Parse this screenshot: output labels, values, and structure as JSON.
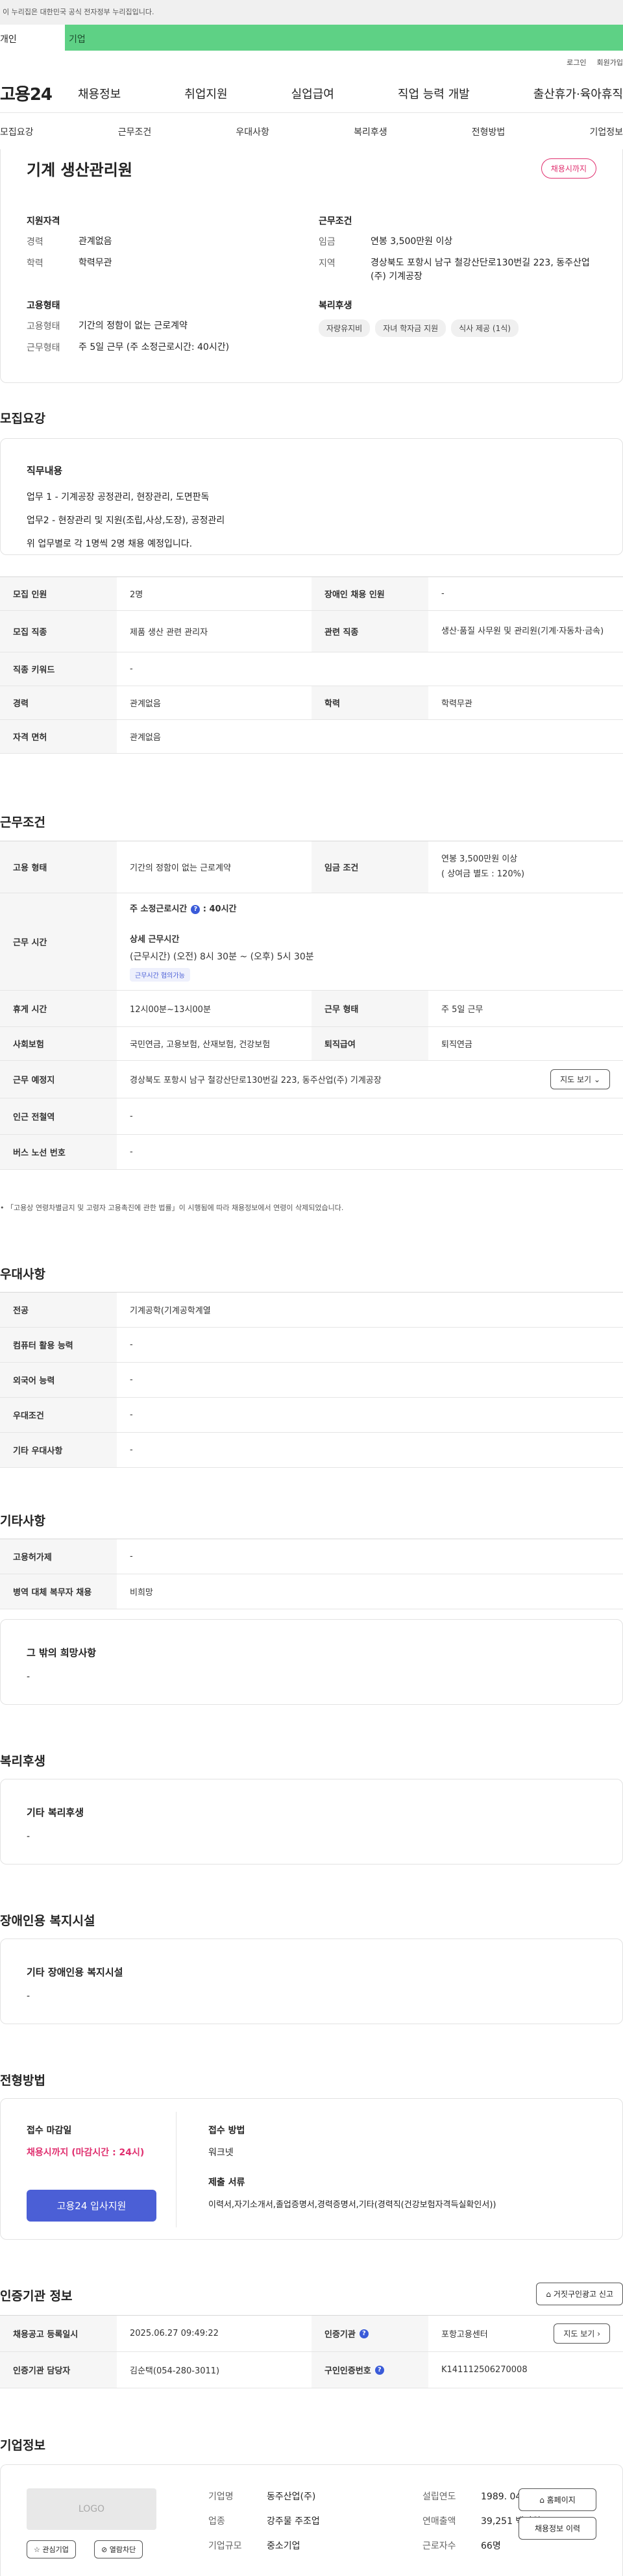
{
  "topbar": {
    "notice": "이 누리집은 대한민국 공식 전자정부 누리집입니다."
  },
  "tabs": {
    "personal": "개인",
    "company": "기업"
  },
  "util": {
    "login": "로그인",
    "join": "회원가입"
  },
  "gnb": {
    "logo": "고용24",
    "items": [
      "채용정보",
      "취업지원",
      "실업급여",
      "직업 능력 개발",
      "출산휴가·육아휴직"
    ]
  },
  "subnav": [
    "모집요강",
    "근무조건",
    "우대사항",
    "복리후생",
    "전형방법",
    "기업정보"
  ],
  "hero": {
    "title": "기계 생산관리원",
    "badge": "채용시까지",
    "qual_title": "지원자격",
    "qual": [
      {
        "k": "경력",
        "v": "관계없음"
      },
      {
        "k": "학력",
        "v": "학력무관"
      }
    ],
    "cond_title": "근무조건",
    "cond": [
      {
        "k": "임금",
        "v": "연봉 3,500만원 이상"
      },
      {
        "k": "지역",
        "v": "경상북도 포항시 남구 철강산단로130번길 223, 동주산업(주) 기계공장"
      }
    ],
    "emp_title": "고용형태",
    "emp": [
      {
        "k": "고용형태",
        "v": "기간의 정함이 없는 근로계약"
      },
      {
        "k": "근무형태",
        "v": "주 5일 근무 (주 소정근로시간: 40시간)"
      }
    ],
    "welfare_title": "복리후생",
    "welfare": [
      "자량유지비",
      "자녀 학자금 지원",
      "식사 제공 (1식)"
    ]
  },
  "recruit": {
    "title": "모집요강",
    "duty_title": "직무내용",
    "duties": [
      "업무 1 - 기계공장 공정관리, 현장관리, 도면판독",
      "업무2 - 현장관리 및 지원(조립,사상,도장), 공정관리",
      "위 업무별로 각 1명씩 2명 채용 예정입니다."
    ],
    "r1": {
      "k1": "모집 인원",
      "v1": "2명",
      "k2": "장애인 채용 인원",
      "v2": "-"
    },
    "r2": {
      "k1": "모집 직종",
      "v1": "제품 생산 관련 관리자",
      "k2": "관련 직종",
      "v2": "생산·품질 사무원 및 관리원(기계·자동차·금속)"
    },
    "r3": {
      "k": "직종 키워드",
      "v": "-"
    },
    "r4": {
      "k1": "경력",
      "v1": "관계없음",
      "k2": "학력",
      "v2": "학력무관"
    },
    "r5": {
      "k": "자격 면허",
      "v": "관계없음"
    }
  },
  "work": {
    "title": "근무조건",
    "r1": {
      "k1": "고용 형태",
      "v1": "기간의 정함이 없는 근로계약",
      "k2": "임금 조건",
      "v2a": "연봉 3,500만원 이상",
      "v2b": "( 상여금 별도 : 120%)"
    },
    "r2": {
      "k": "근무 시간",
      "std": "주 소정근로시간",
      "std_val": ": 40시간",
      "detail_title": "상세 근무시간",
      "detail": "(근무시간) (오전) 8시 30분 ~ (오후) 5시 30분",
      "chip": "근무시간 협의가능"
    },
    "r3": {
      "k1": "휴게 시간",
      "v1": "12시00분~13시00분",
      "k2": "근무 형태",
      "v2": "주 5일 근무"
    },
    "r4": {
      "k1": "사회보험",
      "v1": "국민연금, 고용보험, 산재보험, 건강보험",
      "k2": "퇴직급여",
      "v2": "퇴직연금"
    },
    "r5": {
      "k": "근무 예정지",
      "v": "경상북도 포항시 남구 철강산단로130번길 223, 동주산업(주) 기계공장",
      "btn": "지도 보기"
    },
    "r6": {
      "k": "인근 전철역",
      "v": "-"
    },
    "r7": {
      "k": "버스 노선 번호",
      "v": "-"
    },
    "note": "「고용상 연령차별금지 및 고령자 고용촉진에 관한 법률」이 시행됨에 따라 채용정보에서 연령이 삭제되었습니다."
  },
  "pref": {
    "title": "우대사항",
    "rows": [
      {
        "k": "전공",
        "v": "기계공학(기계공학계열"
      },
      {
        "k": "컴퓨터 활용 능력",
        "v": "-"
      },
      {
        "k": "외국어 능력",
        "v": "-"
      },
      {
        "k": "우대조건",
        "v": "-"
      },
      {
        "k": "기타 우대사항",
        "v": "-"
      }
    ]
  },
  "etc": {
    "title": "기타사항",
    "rows": [
      {
        "k": "고용허가제",
        "v": "-"
      },
      {
        "k": "병역 대체 복무자 채용",
        "v": "비희망"
      }
    ],
    "box_title": "그 밖의 희망사항",
    "box_value": "-"
  },
  "welfare": {
    "title": "복리후생",
    "box_title": "기타 복리후생",
    "box_value": "-"
  },
  "disabled": {
    "title": "장애인용 복지시설",
    "box_title": "기타 장애인용 복지시설",
    "box_value": "-"
  },
  "process": {
    "title": "전형방법",
    "deadline_title": "접수 마감일",
    "deadline": "채용시까지 (마감시간 : 24시)",
    "apply": "고용24 입사지원",
    "method_title": "접수 방법",
    "method": "워크넷",
    "docs_title": "제출 서류",
    "docs": "이력서,자기소개서,졸업증명서,경력증명서,기타(경력직(건강보험자격득실확인서))"
  },
  "cert": {
    "title": "인증기관 정보",
    "report": "거짓구인광고 신고",
    "r1": {
      "k1": "채용공고 등록일시",
      "v1": "2025.06.27 09:49:22",
      "k2": "인증기관",
      "v2": "포항고용센터",
      "btn": "지도 보기"
    },
    "r2": {
      "k1": "인증기관 담당자",
      "v1": "김순택(054-280-3011)",
      "k2": "구인인증번호",
      "v2": "K141112506270008"
    }
  },
  "company": {
    "title": "기업정보",
    "logo": "LOGO",
    "fav": "관심기업",
    "block": "열람차단",
    "info": [
      {
        "k1": "기업명",
        "v1": "동주산업(주)",
        "k2": "설립연도",
        "v2": "1989. 04. 04"
      },
      {
        "k1": "업종",
        "v1": "강주물 주조업",
        "k2": "연매출액",
        "v2": "39,251 백만원"
      },
      {
        "k1": "기업규모",
        "v1": "중소기업",
        "k2": "근로자수",
        "v2": "66명"
      }
    ],
    "home": "홈페이지",
    "history": "채용정보 이력"
  }
}
